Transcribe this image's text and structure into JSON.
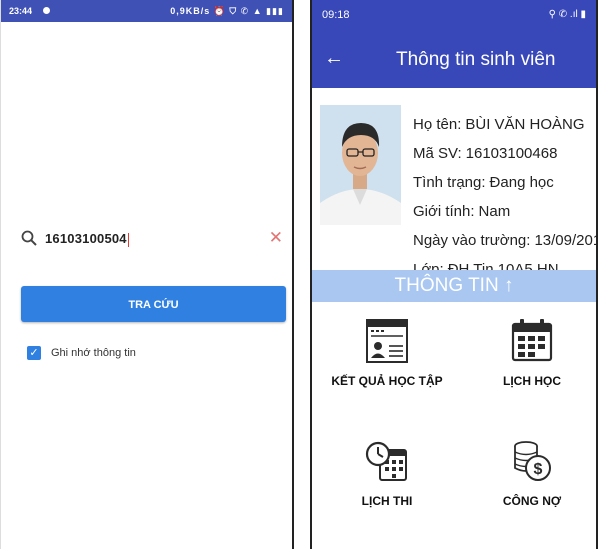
{
  "left_screen": {
    "statusbar": {
      "time": "23:44",
      "icons": "0,9KB/s ⏰ ⛉ ✆ ▲ ▮▮▮"
    },
    "search": {
      "value": "16103100504"
    },
    "lookup_button_label": "TRA CỨU",
    "remember": {
      "label": "Ghi nhớ thông tin",
      "checked": true
    },
    "colors": {
      "primary": "#2f80e0",
      "statusbar": "#3f51b5",
      "clear": "#e57373"
    }
  },
  "right_screen": {
    "statusbar": {
      "time": "09:18",
      "icons": "⚲ ✆ .ıl ▮"
    },
    "appbar": {
      "title": "Thông tin sinh viên",
      "back_icon": "arrow-left-icon"
    },
    "student": {
      "name_label": "Họ tên:",
      "name": "BÙI VĂN HOÀNG",
      "id_label": "Mã SV:",
      "id": "16103100468",
      "status_label": "Tình trạng:",
      "status": "Đang học",
      "gender_label": "Giới tính:",
      "gender": "Nam",
      "enroll_label": "Ngày vào trường:",
      "enroll_date": "13/09/201",
      "class_label": "Lớp:",
      "class": "ĐH Tin 10A5 HN"
    },
    "info_bar_label": "THÔNG TIN ↑",
    "menu": [
      {
        "label": "KẾT QUẢ HỌC TẬP",
        "icon": "report-card-icon"
      },
      {
        "label": "LỊCH HỌC",
        "icon": "calendar-icon"
      },
      {
        "label": "LỊCH THI",
        "icon": "clock-calendar-icon"
      },
      {
        "label": "CÔNG NỢ",
        "icon": "coins-dollar-icon"
      }
    ],
    "colors": {
      "appbar": "#3948b8",
      "info_bar": "#a9c7f0"
    }
  }
}
